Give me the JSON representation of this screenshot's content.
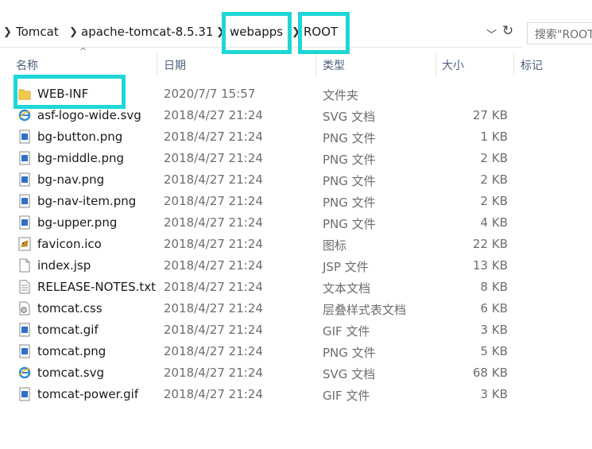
{
  "breadcrumb": {
    "items": [
      "Tomcat",
      "apache-tomcat-8.5.31",
      "webapps",
      "ROOT"
    ]
  },
  "search": {
    "placeholder": "搜索\"ROOT\""
  },
  "columns": {
    "name": "名称",
    "date": "日期",
    "type": "类型",
    "size": "大小",
    "tags": "标记"
  },
  "files": [
    {
      "name": "WEB-INF",
      "date": "2020/7/7 15:57",
      "type": "文件夹",
      "size": "",
      "icon": "folder-icon"
    },
    {
      "name": "asf-logo-wide.svg",
      "date": "2018/4/27 21:24",
      "type": "SVG 文档",
      "size": "27 KB",
      "icon": "ie-svg-icon"
    },
    {
      "name": "bg-button.png",
      "date": "2018/4/27 21:24",
      "type": "PNG 文件",
      "size": "1 KB",
      "icon": "image-file-icon"
    },
    {
      "name": "bg-middle.png",
      "date": "2018/4/27 21:24",
      "type": "PNG 文件",
      "size": "2 KB",
      "icon": "image-file-icon"
    },
    {
      "name": "bg-nav.png",
      "date": "2018/4/27 21:24",
      "type": "PNG 文件",
      "size": "2 KB",
      "icon": "image-file-icon"
    },
    {
      "name": "bg-nav-item.png",
      "date": "2018/4/27 21:24",
      "type": "PNG 文件",
      "size": "2 KB",
      "icon": "image-file-icon"
    },
    {
      "name": "bg-upper.png",
      "date": "2018/4/27 21:24",
      "type": "PNG 文件",
      "size": "4 KB",
      "icon": "image-file-icon"
    },
    {
      "name": "favicon.ico",
      "date": "2018/4/27 21:24",
      "type": "图标",
      "size": "22 KB",
      "icon": "tomcat-favicon-icon"
    },
    {
      "name": "index.jsp",
      "date": "2018/4/27 21:24",
      "type": "JSP 文件",
      "size": "13 KB",
      "icon": "blank-file-icon"
    },
    {
      "name": "RELEASE-NOTES.txt",
      "date": "2018/4/27 21:24",
      "type": "文本文档",
      "size": "8 KB",
      "icon": "text-file-icon"
    },
    {
      "name": "tomcat.css",
      "date": "2018/4/27 21:24",
      "type": "层叠样式表文档",
      "size": "6 KB",
      "icon": "css-file-icon"
    },
    {
      "name": "tomcat.gif",
      "date": "2018/4/27 21:24",
      "type": "GIF 文件",
      "size": "3 KB",
      "icon": "image-file-icon"
    },
    {
      "name": "tomcat.png",
      "date": "2018/4/27 21:24",
      "type": "PNG 文件",
      "size": "5 KB",
      "icon": "image-file-icon"
    },
    {
      "name": "tomcat.svg",
      "date": "2018/4/27 21:24",
      "type": "SVG 文档",
      "size": "68 KB",
      "icon": "ie-svg-icon"
    },
    {
      "name": "tomcat-power.gif",
      "date": "2018/4/27 21:24",
      "type": "GIF 文件",
      "size": "3 KB",
      "icon": "image-file-icon"
    }
  ],
  "colors": {
    "highlight": "#1fd6d6",
    "header_text": "#4c607a",
    "secondary_text": "#6d6d6d",
    "folder": "#f2c94c"
  }
}
